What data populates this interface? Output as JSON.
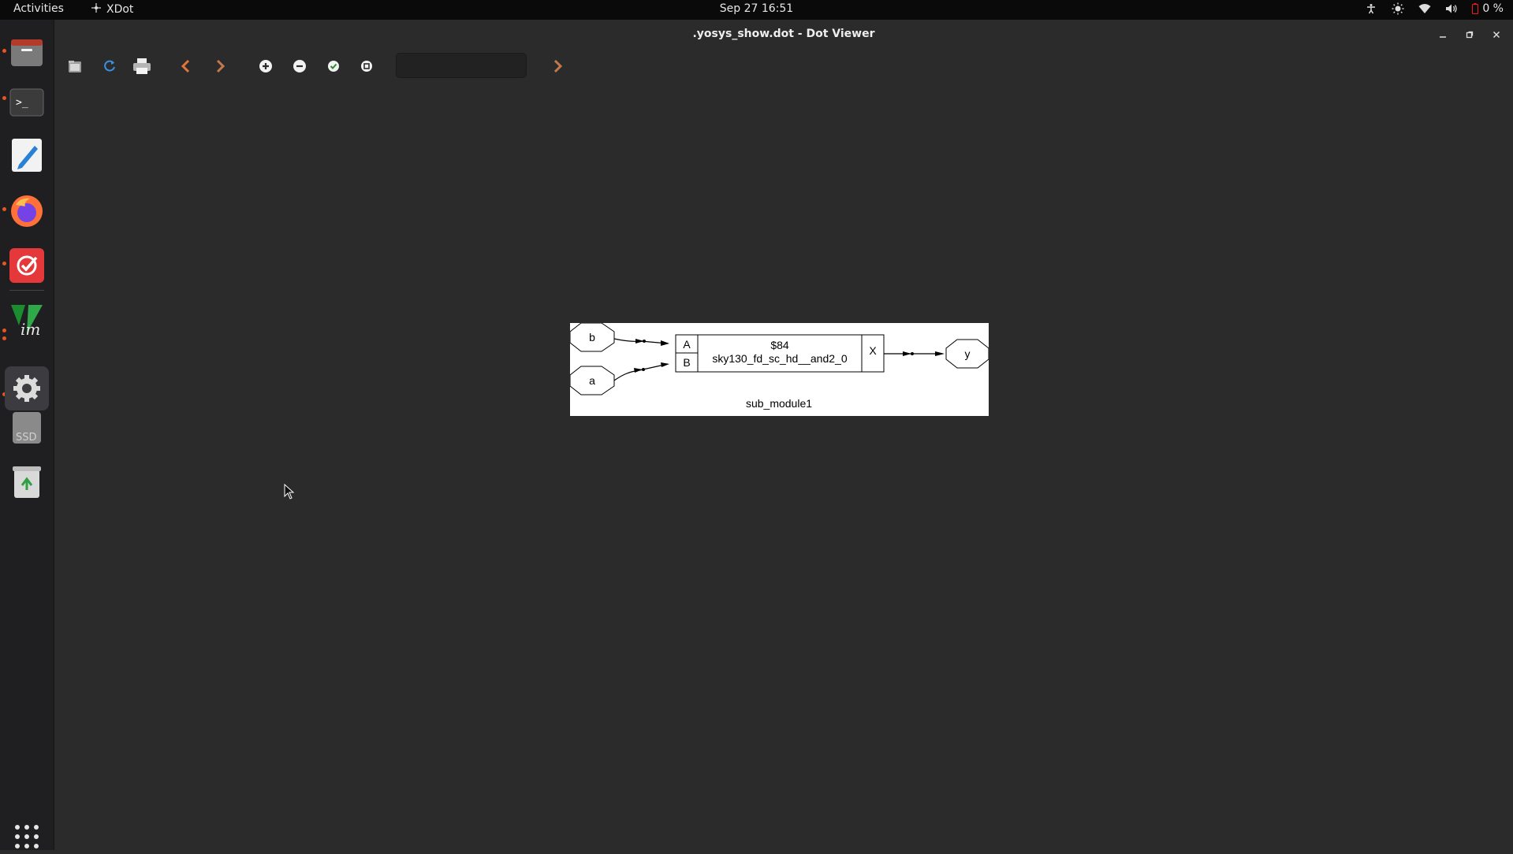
{
  "topbar": {
    "activities": "Activities",
    "app_name": "XDot",
    "clock": "Sep 27  16:51",
    "battery": "0 %"
  },
  "window": {
    "title": ".yosys_show.dot - Dot Viewer"
  },
  "toolbar": {
    "search_value": ""
  },
  "dock": {
    "items": [
      "files-icon",
      "terminal-icon",
      "text-editor-icon",
      "firefox-icon",
      "todo-icon",
      "vim-icon",
      "settings-icon",
      "ssd-drive-icon",
      "trash-icon",
      "show-apps-icon"
    ],
    "ssd_label": "SSD"
  },
  "graph": {
    "input_b": "b",
    "input_a": "a",
    "cell_id": "$84",
    "cell_type": "sky130_fd_sc_hd__and2_0",
    "port_a": "A",
    "port_b": "B",
    "port_x": "X",
    "output_y": "y",
    "module_name": "sub_module1"
  }
}
